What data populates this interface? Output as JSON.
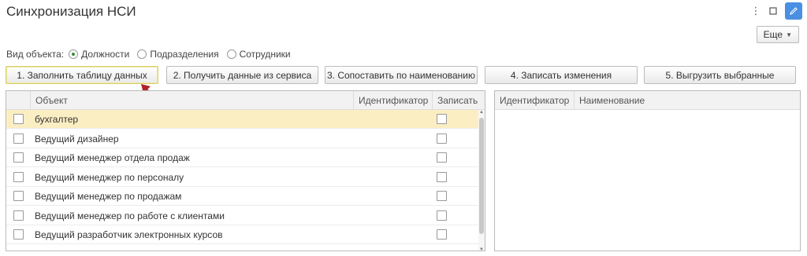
{
  "header": {
    "title": "Синхронизация НСИ",
    "more_label": "Еще",
    "icons": [
      "kebab-menu-icon",
      "maximize-icon",
      "edit-pencil-icon"
    ]
  },
  "object_type": {
    "label": "Вид объекта:",
    "options": [
      "Должности",
      "Подразделения",
      "Сотрудники"
    ],
    "selected": "Должности"
  },
  "buttons": [
    "1. Заполнить таблицу данных",
    "2. Получить данные из сервиса",
    "3. Сопоставить по наименованию",
    "4. Записать изменения",
    "5. Выгрузить выбранные"
  ],
  "left_table": {
    "columns": [
      "Объект",
      "Идентификатор",
      "Записать"
    ],
    "rows": [
      {
        "object": "бухгалтер",
        "selected": true
      },
      {
        "object": "Ведущий дизайнер",
        "selected": false
      },
      {
        "object": "Ведущий менеджер отдела продаж",
        "selected": false
      },
      {
        "object": "Ведущий менеджер по персоналу",
        "selected": false
      },
      {
        "object": "Ведущий менеджер по продажам",
        "selected": false
      },
      {
        "object": "Ведущий менеджер по работе с клиентами",
        "selected": false
      },
      {
        "object": "Ведущий разработчик электронных курсов",
        "selected": false
      }
    ]
  },
  "right_table": {
    "columns": [
      "Идентификатор",
      "Наименование"
    ]
  },
  "colors": {
    "selected_row": "#fbeec3",
    "edit_button": "#4a90e2",
    "arrow": "#b0232a"
  }
}
